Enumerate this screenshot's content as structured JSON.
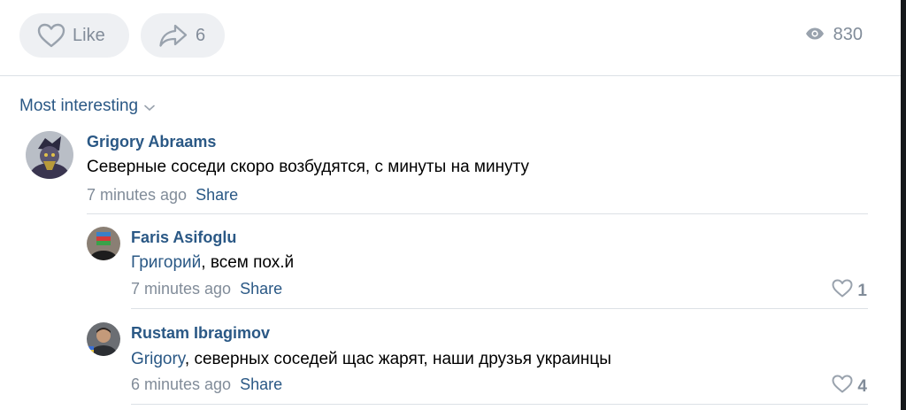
{
  "actions": {
    "like_label": "Like",
    "share_count": "6",
    "views_count": "830"
  },
  "sort": {
    "label": "Most interesting"
  },
  "comments": [
    {
      "author": "Grigory Abraams",
      "text": "Северные соседи скоро возбудятся, с минуты на минуту",
      "time": "7 minutes ago",
      "share_label": "Share"
    },
    {
      "author": "Faris Asifoglu",
      "mention": "Григорий",
      "text": ", всем пох.й",
      "time": "7 minutes ago",
      "share_label": "Share",
      "likes": "1"
    },
    {
      "author": "Rustam Ibragimov",
      "mention": "Grigory",
      "text": ", северных соседей щас жарят, наши друзья украинцы",
      "time": "6 minutes ago",
      "share_label": "Share",
      "likes": "4"
    }
  ]
}
